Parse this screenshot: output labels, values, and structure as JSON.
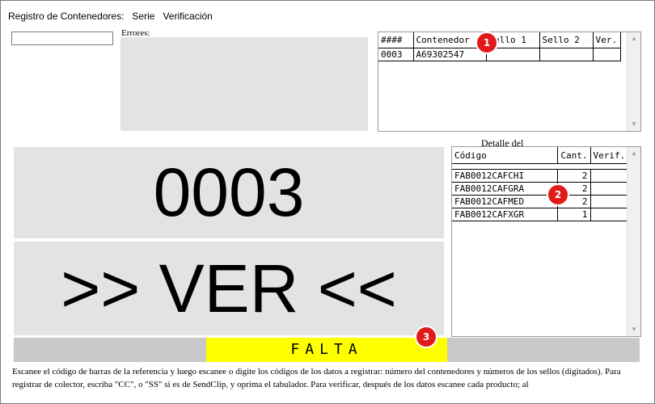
{
  "menu": [
    "Registro de Contenedores:",
    "Serie",
    "Verificación"
  ],
  "scan_input": {
    "value": "",
    "placeholder": ""
  },
  "errors": {
    "label": "Errores:"
  },
  "containers_grid": {
    "columns": [
      "####",
      "Contenedor",
      "Sello 1",
      "Sello 2",
      "Ver."
    ],
    "rows": [
      [
        "0003",
        "A69302547",
        "",
        "",
        ""
      ]
    ]
  },
  "detail": {
    "label": "Detalle del",
    "columns": [
      "Código",
      "Cant.",
      "Verif."
    ],
    "rows": [
      [
        "FAB0012CAFCHI",
        "2",
        ""
      ],
      [
        "FAB0012CAFGRA",
        "2",
        ""
      ],
      [
        "FAB0012CAFMED",
        "2",
        ""
      ],
      [
        "FAB0012CAFXGR",
        "1",
        ""
      ]
    ]
  },
  "big_number": "0003",
  "big_action": ">> VER <<",
  "status": {
    "text": "FALTA"
  },
  "instructions": "Escanee el código de barras de la referencia y luego escanee o digite los códigos de los datos a registrar: número del contenedores y números de los sellos (digitados). Para registrar de colector, escriba \"CC\", o \"SS\" si es de SendClip, y oprima el tabulador. Para verificar, después de los datos escanee cada producto; al",
  "markers": [
    "1",
    "2",
    "3"
  ],
  "colors": {
    "panel": "#e3e3e3",
    "status_bar": "#c8c8c8",
    "status_highlight": "#ffff00",
    "marker": "#e11a1a"
  },
  "icons": [
    "scroll-up-arrow-icon",
    "scroll-down-arrow-icon"
  ]
}
